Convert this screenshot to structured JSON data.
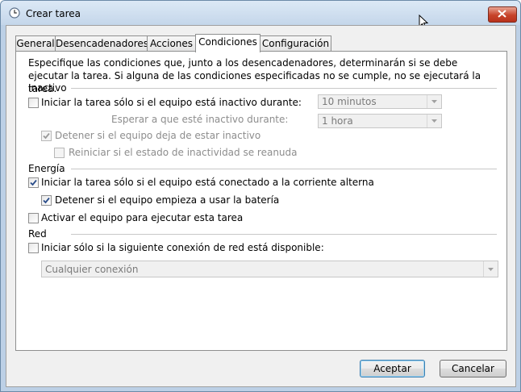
{
  "window": {
    "title": "Crear tarea",
    "icon": "clock-icon"
  },
  "tabs": [
    {
      "label": "General"
    },
    {
      "label": "Desencadenadores"
    },
    {
      "label": "Acciones"
    },
    {
      "label": "Condiciones",
      "active": true
    },
    {
      "label": "Configuración"
    }
  ],
  "description": "Especifique las condiciones que, junto a los desencadenadores, determinarán si se debe ejecutar la tarea. Si alguna de las condiciones especificadas no se cumple, no se ejecutará la tarea.",
  "idle": {
    "heading": "Inactivo",
    "start_if_idle": {
      "label": "Iniciar la tarea sólo si el equipo está inactivo durante:",
      "checked": false
    },
    "idle_duration": {
      "value": "10 minutos"
    },
    "wait_label": "Esperar a que esté inactivo durante:",
    "wait_duration": {
      "value": "1 hora"
    },
    "stop_if_not_idle": {
      "label": "Detener si el equipo deja de estar inactivo",
      "checked": true,
      "enabled": false
    },
    "restart_if_idle": {
      "label": "Reiniciar si el estado de inactividad se reanuda",
      "checked": false,
      "enabled": false
    }
  },
  "power": {
    "heading": "Energía",
    "ac_only": {
      "label": "Iniciar la tarea sólo si el equipo está conectado a la corriente alterna",
      "checked": true
    },
    "stop_on_battery": {
      "label": "Detener si el equipo empieza a usar la batería",
      "checked": true
    },
    "wake": {
      "label": "Activar el equipo para ejecutar esta tarea",
      "checked": false
    }
  },
  "network": {
    "heading": "Red",
    "start_if_network": {
      "label": "Iniciar sólo si la siguiente conexión de red está disponible:",
      "checked": false
    },
    "connection": {
      "value": "Cualquier conexión"
    }
  },
  "buttons": {
    "accept": "Aceptar",
    "cancel": "Cancelar"
  }
}
